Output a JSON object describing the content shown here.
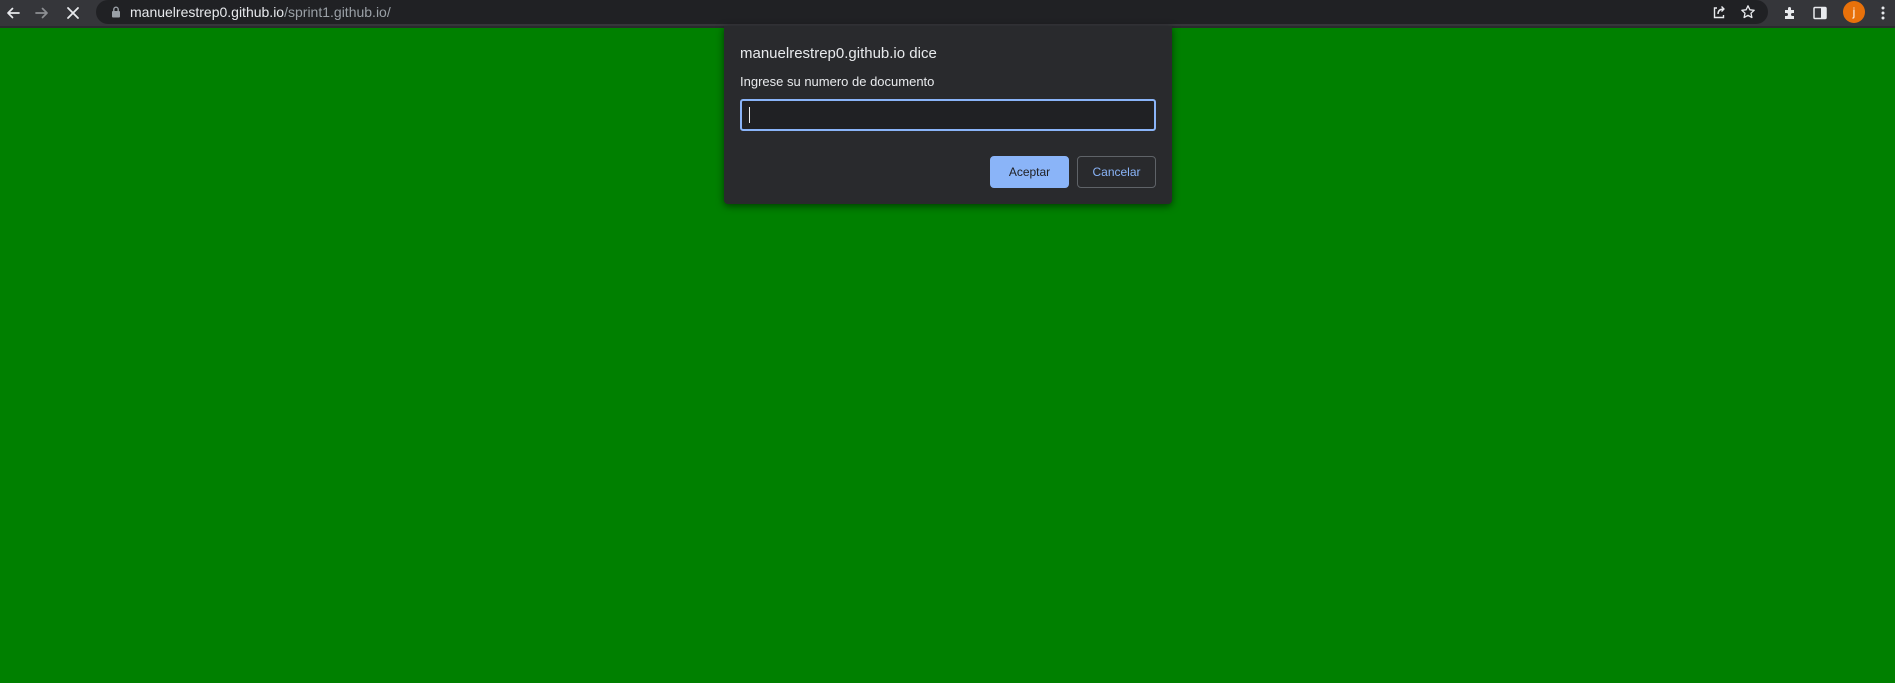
{
  "browser": {
    "url_host": "manuelrestrep0.github.io",
    "url_path": "/sprint1.github.io/",
    "profile_initial": "j",
    "icons": {
      "back": "arrow-left-icon",
      "forward": "arrow-right-icon",
      "stop": "close-icon",
      "lock": "lock-icon",
      "share": "share-icon",
      "bookmark": "star-icon",
      "extensions": "puzzle-icon",
      "side_panel": "side-panel-icon",
      "menu": "kebab-menu-icon"
    }
  },
  "page": {
    "background_color": "#008000"
  },
  "dialog": {
    "title": "manuelrestrep0.github.io dice",
    "message": "Ingrese su numero de documento",
    "input_value": "",
    "accept_label": "Aceptar",
    "cancel_label": "Cancelar"
  },
  "colors": {
    "toolbar": "#35363a",
    "omnibox": "#202124",
    "dialog_bg": "#292a2d",
    "accent": "#8ab4f8",
    "avatar": "#e8710a"
  }
}
